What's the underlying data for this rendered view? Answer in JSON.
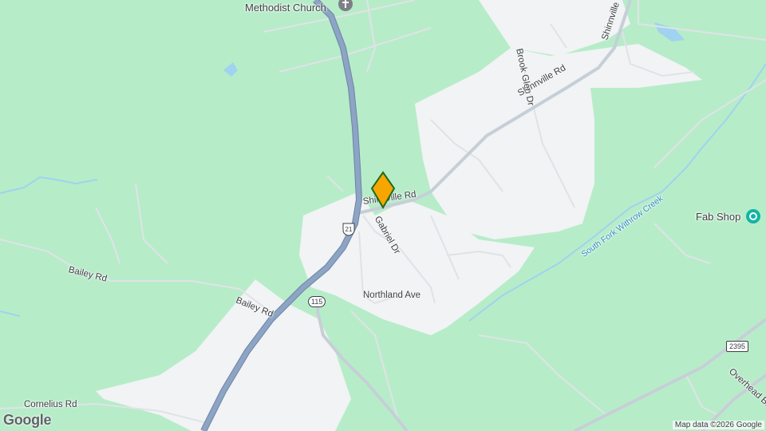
{
  "map": {
    "labels": {
      "methodist_church": "Methodist Church",
      "shinnville_rd_east": "Shinnville Rd",
      "shinnville_rd_west": "Shinnville Rd",
      "shinnville_top": "Shinnville",
      "brook_glen_dr": "Brook Glen Dr",
      "gabriel_dr": "Gabriel Dr",
      "northland_ave": "Northland Ave",
      "bailey_rd_1": "Bailey Rd",
      "bailey_rd_2": "Bailey Rd",
      "cornelius_rd": "Cornelius Rd",
      "overhead_bridge": "Overhead Bridg",
      "south_fork_creek": "South Fork Withrow Creek",
      "fab_shop": "Fab Shop"
    },
    "shields": {
      "us21": "21",
      "nc115": "115",
      "sr2395": "2395"
    },
    "attribution": "Map data ©2026 Google",
    "logo": "Google",
    "colors": {
      "land": "#b7ecc9",
      "urban": "#f1f3f4",
      "highway": "#8da4c4",
      "road": "#ffffff",
      "water": "#9fd3ef",
      "pin": "#f7a600",
      "pin_border": "#1e6b1e"
    },
    "icons": {
      "church_marker": "church-pin-icon",
      "fab_shop_marker": "shop-pin-icon",
      "location": "location-pin-icon"
    }
  }
}
